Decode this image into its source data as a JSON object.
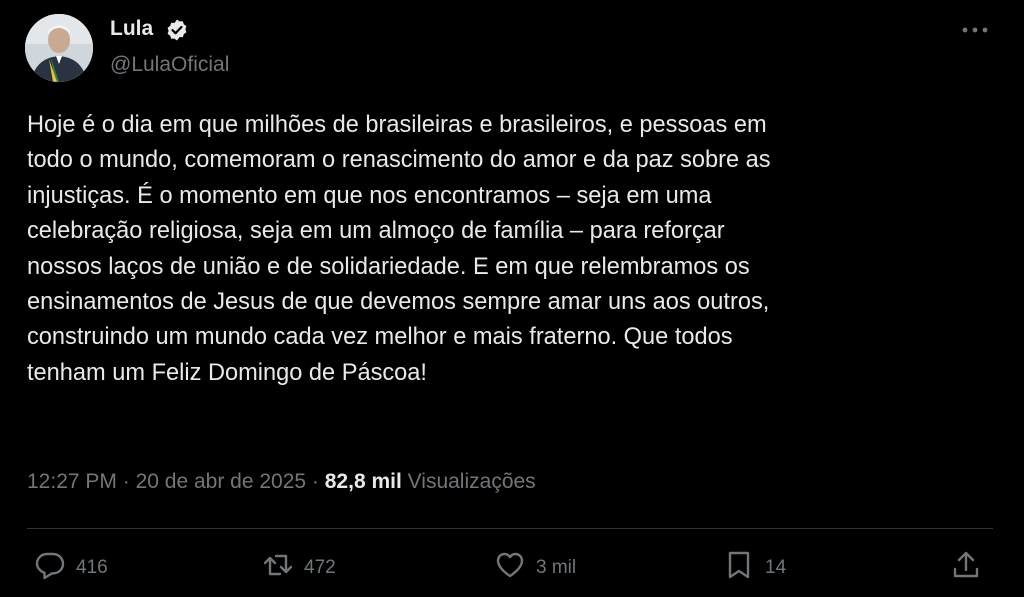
{
  "author": {
    "display_name": "Lula",
    "handle": "@LulaOficial",
    "verified": true
  },
  "tweet": {
    "text": "Hoje é o dia em que milhões de brasileiras e brasileiros, e pessoas em\ntodo o mundo, comemoram o renascimento do amor e da paz sobre as\ninjustiças. É o momento em que nos encontramos – seja em uma\ncelebração religiosa, seja em um almoço de família – para reforçar\nnossos laços de união e de solidariedade. E em que relembramos os\nensinamentos de Jesus de que devemos sempre amar uns aos outros,\nconstruindo um mundo cada vez melhor e mais fraterno. Que todos\ntenham um Feliz Domingo de Páscoa!",
    "time": "12:27 PM",
    "separator": "·",
    "date": "20 de abr de 2025",
    "views_count": "82,8 mil",
    "views_label": "Visualizações"
  },
  "actions": {
    "replies": "416",
    "reposts": "472",
    "likes": "3 mil",
    "bookmarks": "14"
  },
  "icons": [
    "verified-badge-icon",
    "more-icon",
    "reply-icon",
    "repost-icon",
    "like-icon",
    "bookmark-icon",
    "share-icon"
  ],
  "colors": {
    "background": "#000000",
    "text": "#e7e9ea",
    "muted": "#71767b",
    "divider": "#2f3336"
  }
}
